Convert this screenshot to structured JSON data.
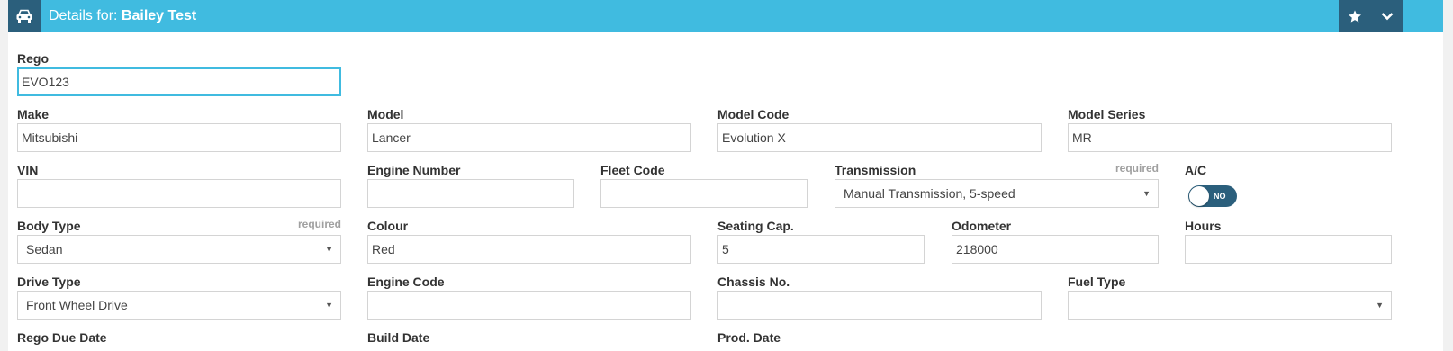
{
  "header": {
    "title_prefix": "Details for:",
    "title_name": "Bailey Test",
    "icons": [
      "car-icon",
      "star-icon",
      "chevron-down-icon"
    ]
  },
  "colors": {
    "header_bg": "#40bbe0",
    "header_btn": "#2b5f7c",
    "focus_border": "#40bbe0",
    "toggle_bg": "#2b5f7c"
  },
  "required_text": "required",
  "fields": {
    "rego": {
      "label": "Rego",
      "value": "EVO123"
    },
    "make": {
      "label": "Make",
      "value": "Mitsubishi"
    },
    "model": {
      "label": "Model",
      "value": "Lancer"
    },
    "model_code": {
      "label": "Model Code",
      "value": "Evolution X"
    },
    "model_series": {
      "label": "Model Series",
      "value": "MR"
    },
    "vin": {
      "label": "VIN",
      "value": ""
    },
    "engine_number": {
      "label": "Engine Number",
      "value": ""
    },
    "fleet_code": {
      "label": "Fleet Code",
      "value": ""
    },
    "transmission": {
      "label": "Transmission",
      "value": "Manual Transmission, 5-speed"
    },
    "ac": {
      "label": "A/C",
      "toggle_text": "NO"
    },
    "body_type": {
      "label": "Body Type",
      "value": "Sedan"
    },
    "colour": {
      "label": "Colour",
      "value": "Red"
    },
    "seating_cap": {
      "label": "Seating Cap.",
      "value": "5"
    },
    "odometer": {
      "label": "Odometer",
      "value": "218000"
    },
    "hours": {
      "label": "Hours",
      "value": ""
    },
    "drive_type": {
      "label": "Drive Type",
      "value": "Front Wheel Drive"
    },
    "engine_code": {
      "label": "Engine Code",
      "value": ""
    },
    "chassis_no": {
      "label": "Chassis No.",
      "value": ""
    },
    "fuel_type": {
      "label": "Fuel Type",
      "value": ""
    },
    "rego_due_date": {
      "label": "Rego Due Date"
    },
    "build_date": {
      "label": "Build Date"
    },
    "prod_date": {
      "label": "Prod. Date"
    }
  }
}
